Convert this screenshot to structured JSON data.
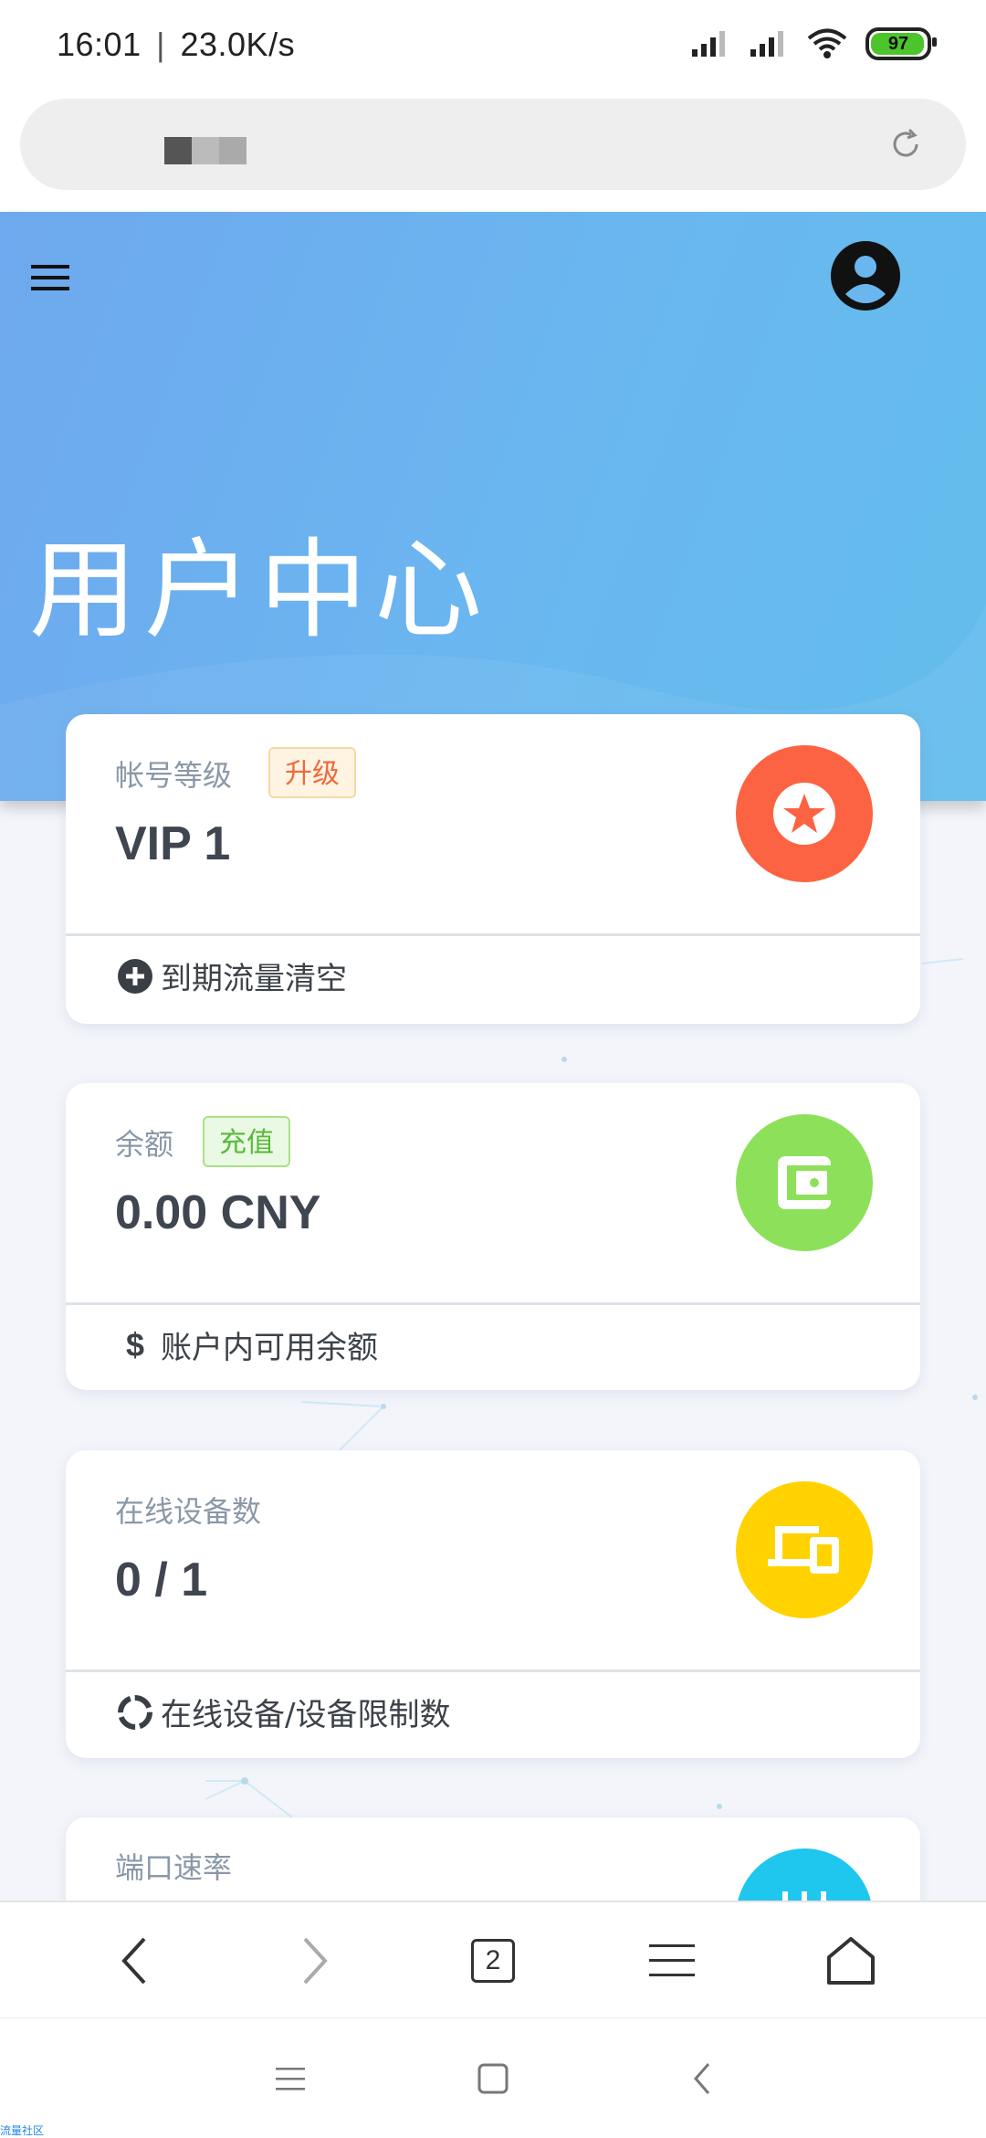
{
  "status_bar": {
    "time": "16:01",
    "speed": "23.0K/s",
    "battery": "97",
    "icons": [
      "signal-icon",
      "signal-icon",
      "wifi-icon",
      "battery-icon"
    ]
  },
  "browser": {
    "reload_icon": "reload-icon"
  },
  "hero": {
    "title": "用户中心",
    "menu_icon": "hamburger-menu-icon",
    "avatar_icon": "user-avatar-icon"
  },
  "cards": [
    {
      "label": "帐号等级",
      "tag": "升级",
      "value": "VIP 1",
      "footer": "到期流量清空",
      "icon": "star-icon",
      "footer_icon": "plus-circle-icon",
      "color": "#fc6342"
    },
    {
      "label": "余额",
      "tag": "充值",
      "value": "0.00 CNY",
      "footer": "账户内可用余额",
      "icon": "wallet-icon",
      "footer_icon": "dollar-icon",
      "color": "#8de15a"
    },
    {
      "label": "在线设备数",
      "value": "0 / 1",
      "footer": "在线设备/设备限制数",
      "icon": "devices-icon",
      "footer_icon": "loading-circle-icon",
      "color": "#ffd200"
    },
    {
      "label": "端口速率",
      "icon": "equalizer-icon",
      "color": "#1fc6ee"
    }
  ],
  "bottom_nav": {
    "tabs_count": "2",
    "icons": [
      "back-arrow-icon",
      "forward-arrow-icon",
      "tabs-icon",
      "menu-icon",
      "home-icon"
    ]
  },
  "system_nav": {
    "icons": [
      "recent-apps-icon",
      "home-square-icon",
      "back-icon"
    ]
  },
  "watermark": "流量社区"
}
